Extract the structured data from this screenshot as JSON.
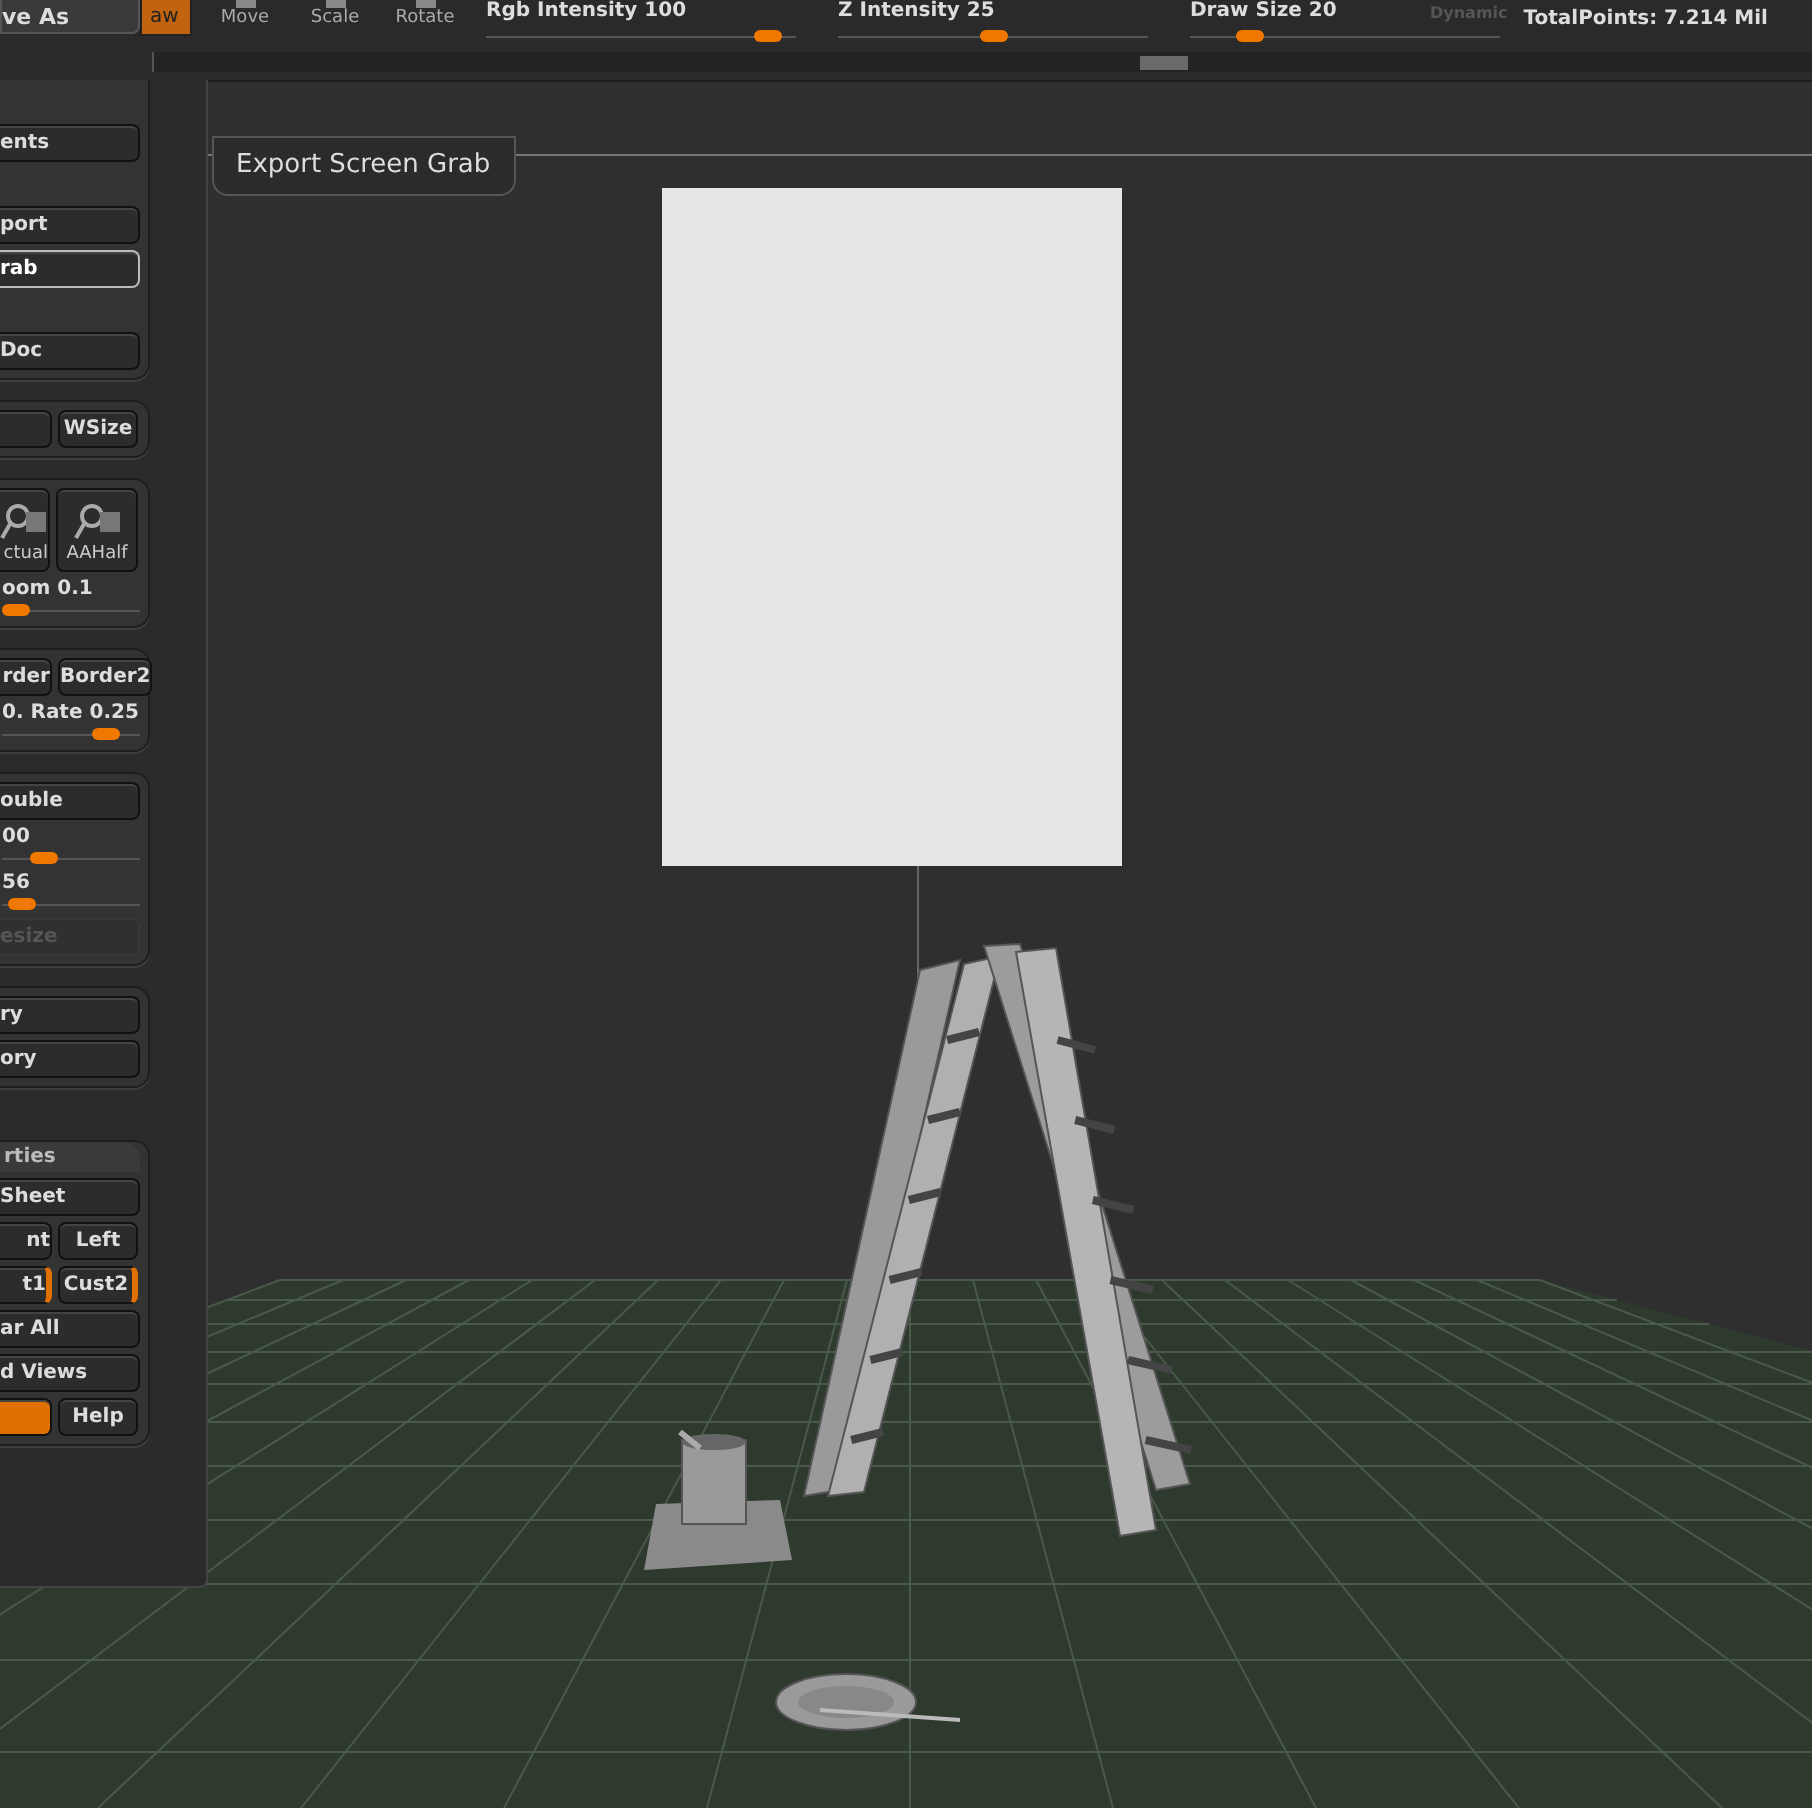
{
  "top_bar": {
    "save_button": "ve As",
    "draw_button": {
      "label": "aw",
      "selected": true
    },
    "tools": [
      {
        "label": "Move"
      },
      {
        "label": "Scale"
      },
      {
        "label": "Rotate"
      }
    ],
    "sliders": [
      {
        "label": "Rgb Intensity",
        "value": "100",
        "level": 0.95
      },
      {
        "label": "Z Intensity",
        "value": "25",
        "level": 0.5
      },
      {
        "label": "Draw Size",
        "value": "20",
        "level": 0.16
      }
    ],
    "dynamic": "Dynamic",
    "total_points": "TotalPoints: 7.214 Mil"
  },
  "left_panel": {
    "groups": [
      {
        "sections": [
          [
            {
              "kind": "button",
              "label": "ents"
            }
          ],
          [
            {
              "kind": "button",
              "label": "port"
            },
            {
              "kind": "button",
              "label": "rab",
              "selected": true
            }
          ],
          [
            {
              "kind": "button",
              "label": "Doc"
            }
          ]
        ]
      },
      {
        "sections": [
          [
            {
              "kind": "row",
              "buttons": [
                {
                  "kind": "blank"
                },
                {
                  "kind": "text",
                  "label": "WSize"
                }
              ]
            }
          ]
        ]
      },
      {
        "sections": [
          [
            {
              "kind": "icons",
              "buttons": [
                {
                  "label": "ctual"
                },
                {
                  "label": "AAHalf"
                }
              ]
            },
            {
              "kind": "slider",
              "label": "oom 0.1",
              "level": 0.0
            }
          ]
        ]
      },
      {
        "sections": [
          [
            {
              "kind": "row",
              "buttons": [
                {
                  "label": "rder"
                },
                {
                  "label": "Border2"
                }
              ]
            },
            {
              "kind": "slider_pair",
              "label": "0. Rate 0.25",
              "level": 0.82
            }
          ]
        ]
      },
      {
        "sections": [
          [
            {
              "kind": "button",
              "label": "ouble"
            },
            {
              "kind": "slider",
              "label": "00",
              "level": 0.25
            },
            {
              "kind": "slider",
              "label": "56",
              "level": 0.05
            },
            {
              "kind": "button",
              "label": "esize",
              "disabled": true
            }
          ]
        ]
      },
      {
        "sections": [
          [
            {
              "kind": "button",
              "label": "ry"
            },
            {
              "kind": "button",
              "label": "ory"
            }
          ]
        ]
      },
      {
        "title": "rties",
        "sections": [
          [
            {
              "kind": "button",
              "label": "Sheet"
            },
            {
              "kind": "row",
              "buttons": [
                {
                  "label": "nt"
                },
                {
                  "label": "Left"
                }
              ]
            },
            {
              "kind": "row",
              "buttons": [
                {
                  "label": "t1",
                  "marked": true
                },
                {
                  "label": "Cust2",
                  "marked": true
                }
              ]
            },
            {
              "kind": "short_button",
              "label": "ar All"
            },
            {
              "kind": "short_button",
              "label": "d Views"
            },
            {
              "kind": "row",
              "buttons": [
                {
                  "kind": "blank",
                  "active": true
                },
                {
                  "kind": "text",
                  "label": "Help"
                }
              ]
            }
          ]
        ]
      }
    ]
  },
  "tooltip": "Export Screen Grab"
}
